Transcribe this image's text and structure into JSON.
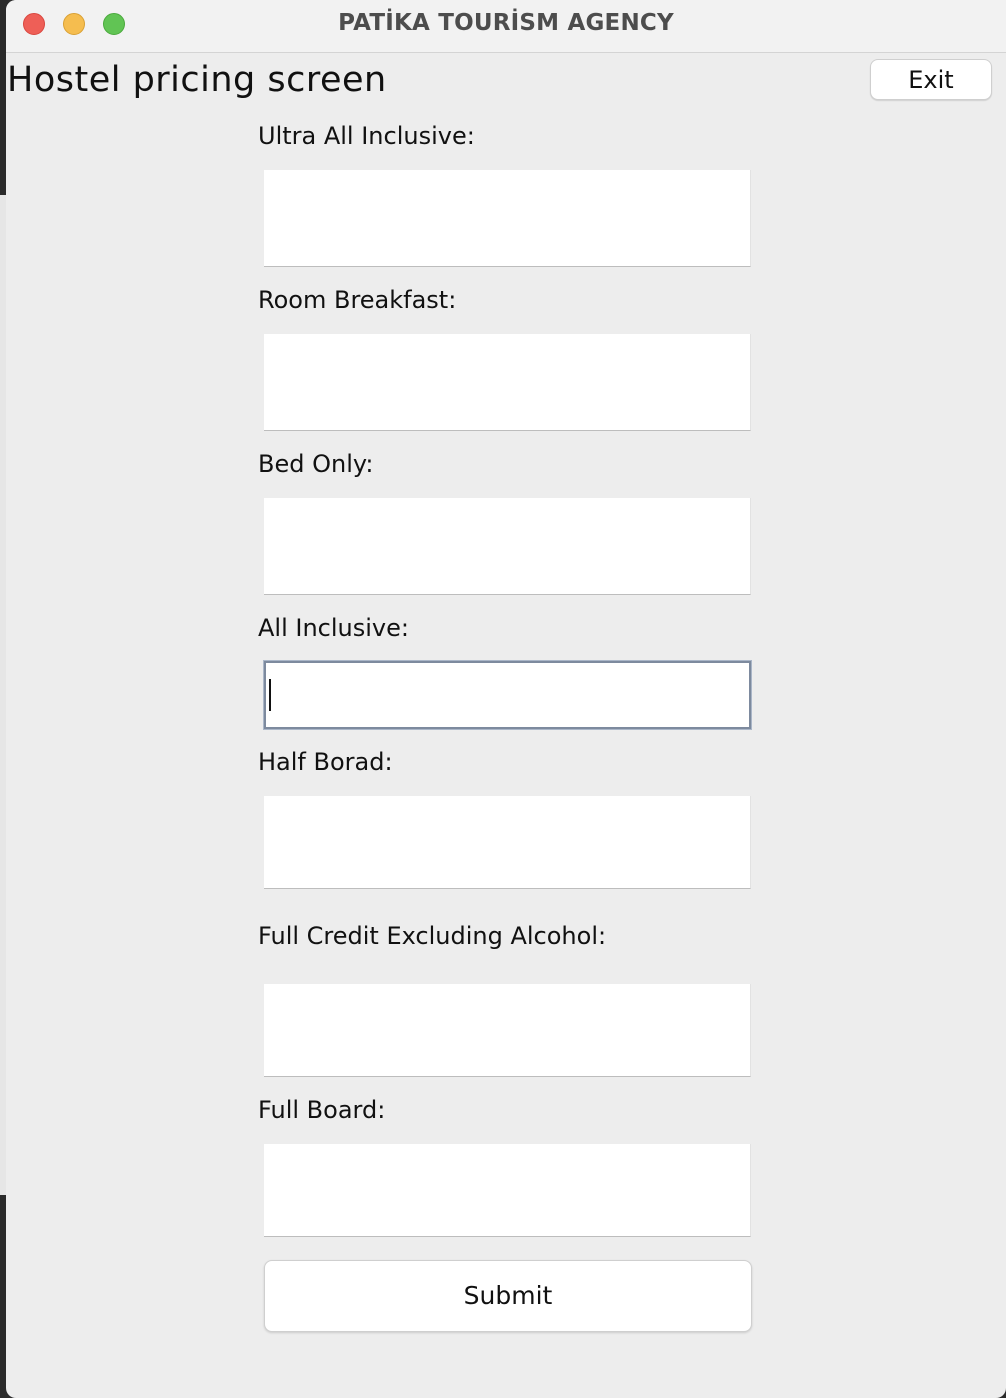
{
  "window": {
    "title": "PATİKA TOURİSM AGENCY"
  },
  "page": {
    "heading": "Hostel pricing screen",
    "exit_label": "Exit",
    "submit_label": "Submit"
  },
  "fields": [
    {
      "label": "Ultra All Inclusive:",
      "value": ""
    },
    {
      "label": "Room Breakfast:",
      "value": ""
    },
    {
      "label": "Bed Only:",
      "value": ""
    },
    {
      "label": "All Inclusive:",
      "value": ""
    },
    {
      "label": "Half Borad:",
      "value": ""
    },
    {
      "label": "Full Credit Excluding Alcohol:",
      "value": ""
    },
    {
      "label": "Full Board:",
      "value": ""
    }
  ],
  "colors": {
    "close": "#ee5f57",
    "minimize": "#f5bd4f",
    "maximize": "#61c454",
    "window_bg": "#ededed",
    "focus_border": "#7d8a9e"
  }
}
